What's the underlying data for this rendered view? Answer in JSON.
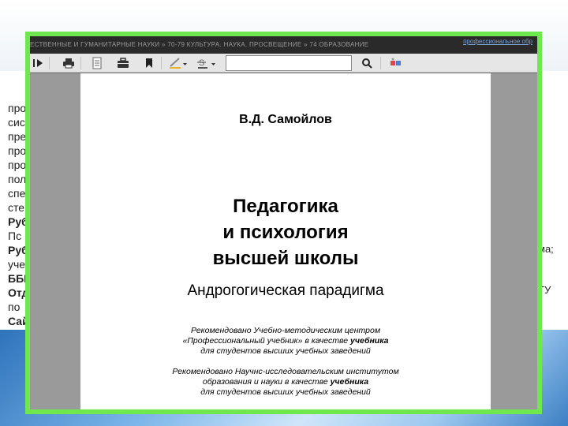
{
  "background": {
    "left_lines": [
      "про",
      "сис",
      "пре",
      "про",
      "про",
      "пол",
      "спе",
      "сте",
      "Руб",
      "Пс",
      "Руб",
      "уче",
      "ББК",
      "Отд",
      "по",
      "Сай"
    ],
    "left_bold": [
      false,
      false,
      false,
      false,
      false,
      false,
      false,
      false,
      true,
      false,
      true,
      false,
      true,
      true,
      false,
      true
    ],
    "right_lines": [
      "ма;",
      "ТУ"
    ]
  },
  "header": {
    "categories": "ЕСТВЕННЫЕ И ГУМАНИТАРНЫЕ НАУКИ » 70-79 КУЛЬТУРА. НАУКА. ПРОСВЕЩЕНИЕ » 74 ОБРАЗОВАНИЕ",
    "link": "профессиональное обр"
  },
  "toolbar": {
    "search_value": ""
  },
  "document": {
    "author": "В.Д. Самойлов",
    "title_lines": [
      "Педагогика",
      "и психология",
      "высшей школы"
    ],
    "subtitle": "Андрогогическая парадигма",
    "rec1": {
      "line1": "Рекомендовано Учебно-методическим центром",
      "line2_pre": "«Профессиональный учебник» в качестве ",
      "line2_bold": "учебника",
      "line3": "для студентов высших учебных заведений"
    },
    "rec2": {
      "line1": "Рекомендовано Научнс-исследовательским институтом",
      "line2_pre": "образования и науки в качестве ",
      "line2_bold": "учебника",
      "line3": "для студентов высших учебных заведений"
    }
  },
  "colors": {
    "frame": "#6ee84e",
    "header_bg": "#2a2a2a",
    "toolbar_bg": "#e6e6e6"
  }
}
